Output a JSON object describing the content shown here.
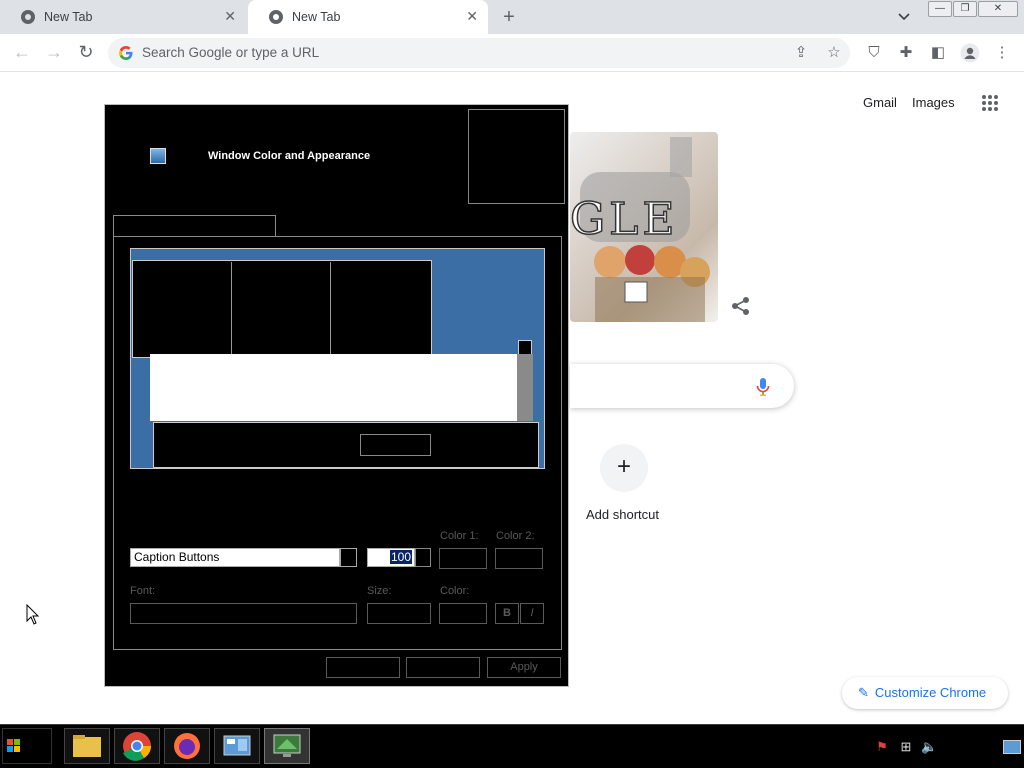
{
  "browser": {
    "tabs": [
      {
        "title": "New Tab",
        "active": false
      },
      {
        "title": "New Tab",
        "active": true
      }
    ],
    "new_tab_symbol": "+",
    "omnibox_placeholder": "Search Google or type a URL",
    "window_controls": {
      "minimize": "—",
      "restore": "❐",
      "close": "✕"
    }
  },
  "ntp": {
    "links": {
      "gmail": "Gmail",
      "images": "Images"
    },
    "add_shortcut_label": "Add shortcut",
    "add_shortcut_symbol": "+",
    "doodle_text": "GLE",
    "customize_label": "Customize Chrome"
  },
  "dialog": {
    "title": "Window Color and Appearance",
    "item_value": "Caption Buttons",
    "size_value": "100",
    "labels": {
      "color1": "Color 1:",
      "color2": "Color 2:",
      "font": "Font:",
      "size": "Size:",
      "color": "Color:",
      "bold": "B",
      "italic": "I"
    },
    "buttons": {
      "ok": "",
      "cancel": "",
      "apply": "Apply"
    }
  },
  "taskbar": {
    "apps": [
      "start",
      "file-explorer",
      "chrome",
      "firefox",
      "control-panel",
      "display-settings"
    ]
  },
  "colors": {
    "chrome_tabstrip": "#dee1e6",
    "preview_desktop": "#3a6ea5",
    "link_blue": "#1a73e8",
    "dialog_bg": "#000000"
  }
}
